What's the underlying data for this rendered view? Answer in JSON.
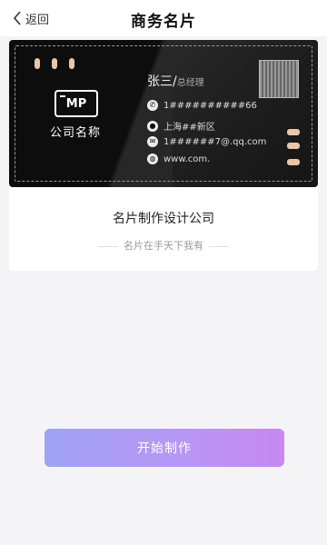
{
  "header": {
    "back_label": "返回",
    "title": "商务名片"
  },
  "card": {
    "logo_text": "MP",
    "company_name": "公司名称",
    "person_name": "张三/",
    "person_sub": "总经理",
    "phone": "1##########66",
    "address": "上海##新区",
    "email": "1######7@.qq.com",
    "website": "www.com."
  },
  "info": {
    "slogan_title": "名片制作设计公司",
    "slogan_sub": "名片在手天下我有"
  },
  "actions": {
    "start_label": "开始制作"
  },
  "colors": {
    "button_start": "#a0a3f3",
    "button_end": "#c889f0",
    "card_bg": "#0d0d0d",
    "accent_pill": "#e8c7a8"
  }
}
